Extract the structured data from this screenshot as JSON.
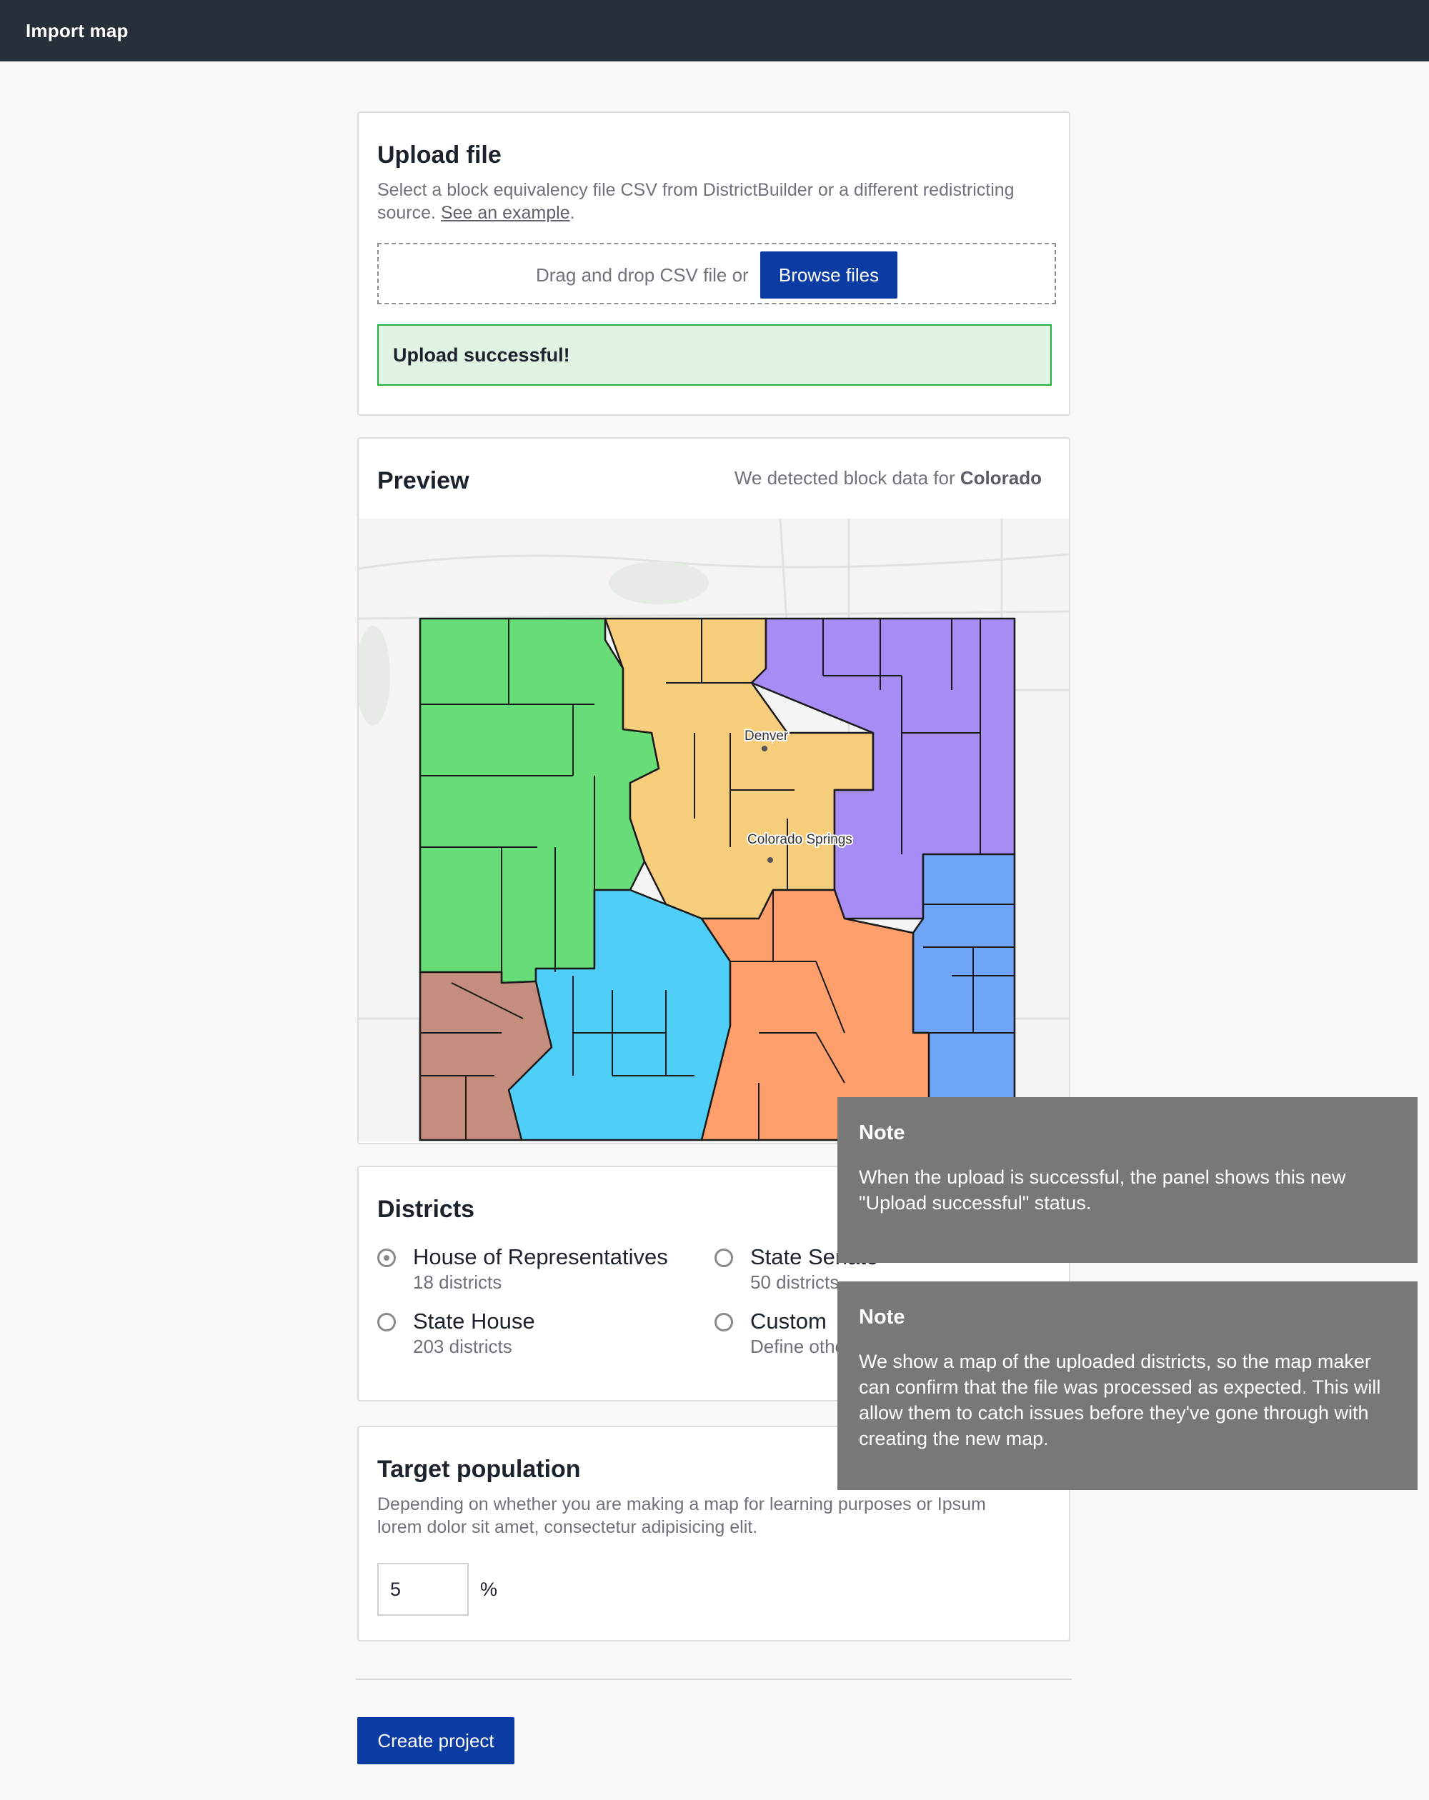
{
  "topbar": {
    "title": "Import map"
  },
  "upload": {
    "title": "Upload file",
    "description": "Select a block equivalency file CSV from DistrictBuilder or a different redistricting source.",
    "example_link": "See an example",
    "period": ".",
    "drop_text": "Drag and drop CSV file or",
    "browse_label": "Browse files",
    "status": "Upload successful!"
  },
  "preview": {
    "title": "Preview",
    "detected_prefix": "We detected block data for",
    "state": "Colorado",
    "cities": [
      "Denver",
      "Colorado Springs"
    ],
    "district_colors": [
      "#66dd77",
      "#f6cd7a",
      "#a88cf6",
      "#6fa5f7",
      "#4fcff7",
      "#ff9f6b",
      "#c48d7d"
    ]
  },
  "districts": {
    "title": "Districts",
    "options": [
      {
        "label": "House of Representatives",
        "sub": "18 districts",
        "selected": true
      },
      {
        "label": "State Senate",
        "sub": "50 districts",
        "selected": false
      },
      {
        "label": "State House",
        "sub": "203 districts",
        "selected": false
      },
      {
        "label": "Custom",
        "sub": "Define other",
        "selected": false
      }
    ]
  },
  "target_population": {
    "title": "Target population",
    "description": "Depending on whether you are making a map for learning purposes or Ipsum lorem dolor sit amet, consectetur adipisicing elit.",
    "value": "5",
    "unit": "%"
  },
  "create_label": "Create project",
  "notes": [
    {
      "title": "Note",
      "body": "When the upload is successful, the panel shows this new \"Upload successful\" status."
    },
    {
      "title": "Note",
      "body": "We show a map of the uploaded districts, so the map maker can confirm that the file was processed as expected. This will allow them to catch issues before they've gone through with creating the new map."
    }
  ]
}
